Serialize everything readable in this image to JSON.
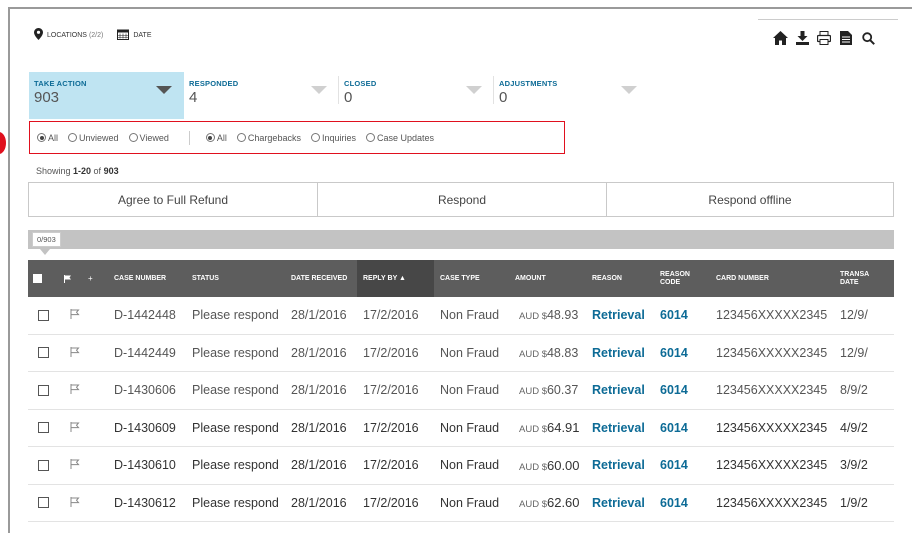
{
  "topbar": {
    "locations_label": "LOCATIONS",
    "locations_count": "(2/2)",
    "date_label": "DATE"
  },
  "toolbar_icons": [
    "home-icon",
    "download-icon",
    "print-icon",
    "document-icon",
    "search-icon"
  ],
  "tabs": [
    {
      "label": "TAKE ACTION",
      "count": "903",
      "active": true
    },
    {
      "label": "RESPONDED",
      "count": "4",
      "active": false
    },
    {
      "label": "CLOSED",
      "count": "0",
      "active": false
    },
    {
      "label": "ADJUSTMENTS",
      "count": "0",
      "active": false
    }
  ],
  "filters": {
    "view_group": [
      {
        "label": "All",
        "selected": true
      },
      {
        "label": "Unviewed",
        "selected": false
      },
      {
        "label": "Viewed",
        "selected": false
      }
    ],
    "type_group": [
      {
        "label": "All",
        "selected": true
      },
      {
        "label": "Chargebacks",
        "selected": false
      },
      {
        "label": "Inquiries",
        "selected": false
      },
      {
        "label": "Case Updates",
        "selected": false
      }
    ]
  },
  "showing": {
    "prefix": "Showing ",
    "range": "1-20",
    "of": " of ",
    "total": "903"
  },
  "actions": {
    "refund": "Agree to Full Refund",
    "respond": "Respond",
    "offline": "Respond offline"
  },
  "selection": {
    "count": "0/903"
  },
  "columns": [
    "CASE NUMBER",
    "STATUS",
    "DATE RECEIVED",
    "REPLY BY ▲",
    "CASE TYPE",
    "AMOUNT",
    "REASON",
    "REASON CODE",
    "CARD NUMBER",
    "TRANSA DATE"
  ],
  "rows": [
    {
      "case": "D-1442448",
      "status": "Please respond",
      "received": "28/1/2016",
      "reply_by": "17/2/2016",
      "type": "Non Fraud",
      "currency": "AUD $",
      "amount": "48.93",
      "reason": "Retrieval",
      "code": "6014",
      "card": "123456XXXXX2345",
      "trans_date": "12/9/"
    },
    {
      "case": "D-1442449",
      "status": "Please respond",
      "received": "28/1/2016",
      "reply_by": "17/2/2016",
      "type": "Non Fraud",
      "currency": "AUD $",
      "amount": "48.83",
      "reason": "Retrieval",
      "code": "6014",
      "card": "123456XXXXX2345",
      "trans_date": "12/9/"
    },
    {
      "case": "D-1430606",
      "status": "Please respond",
      "received": "28/1/2016",
      "reply_by": "17/2/2016",
      "type": "Non Fraud",
      "currency": "AUD $",
      "amount": "60.37",
      "reason": "Retrieval",
      "code": "6014",
      "card": "123456XXXXX2345",
      "trans_date": "8/9/2"
    },
    {
      "case": "D-1430609",
      "status": "Please respond",
      "received": "28/1/2016",
      "reply_by": "17/2/2016",
      "type": "Non Fraud",
      "currency": "AUD $",
      "amount": "64.91",
      "reason": "Retrieval",
      "code": "6014",
      "card": "123456XXXXX2345",
      "trans_date": "4/9/2"
    },
    {
      "case": "D-1430610",
      "status": "Please respond",
      "received": "28/1/2016",
      "reply_by": "17/2/2016",
      "type": "Non Fraud",
      "currency": "AUD $",
      "amount": "60.00",
      "reason": "Retrieval",
      "code": "6014",
      "card": "123456XXXXX2345",
      "trans_date": "3/9/2"
    },
    {
      "case": "D-1430612",
      "status": "Please respond",
      "received": "28/1/2016",
      "reply_by": "17/2/2016",
      "type": "Non Fraud",
      "currency": "AUD $",
      "amount": "62.60",
      "reason": "Retrieval",
      "code": "6014",
      "card": "123456XXXXX2345",
      "trans_date": "1/9/2"
    }
  ],
  "colors": {
    "accent": "#0d6b96",
    "active_tab": "#bfe4f2",
    "header": "#5d5d5d",
    "highlight": "#e0101e"
  }
}
